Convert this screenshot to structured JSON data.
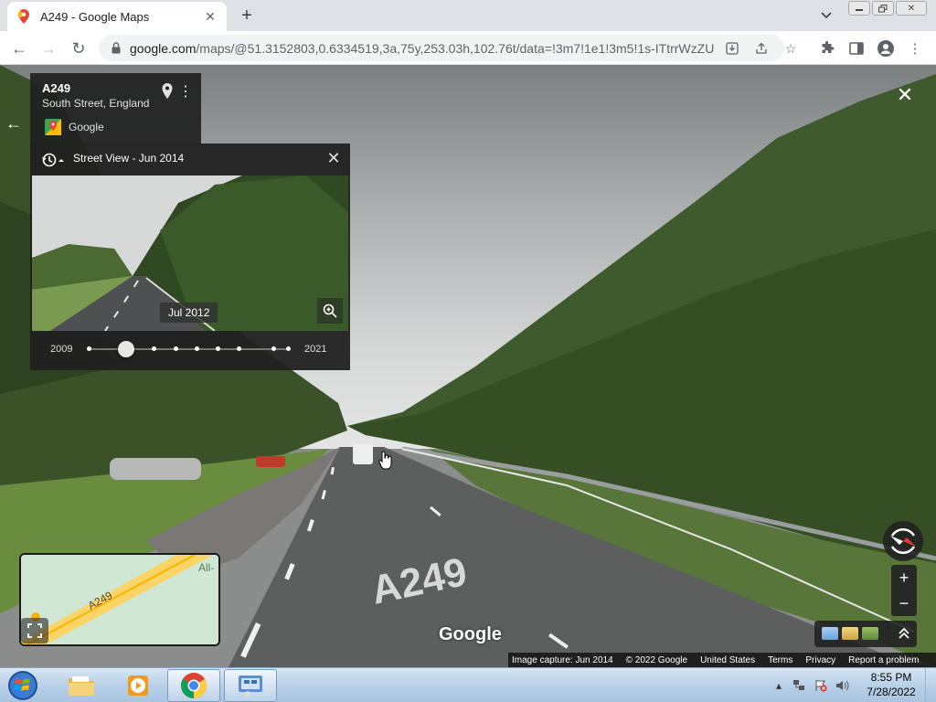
{
  "browser": {
    "tab_title": "A249 - Google Maps",
    "url_domain": "google.com",
    "url_path": "/maps/@51.3152803,0.6334519,3a,75y,253.03h,102.76t/data=!3m7!1e1!3m5!1s-ITtrrWzZU..."
  },
  "place": {
    "title": "A249",
    "subtitle": "South Street, England",
    "brand": "Google"
  },
  "timemachine": {
    "header": "Street View - Jun 2014",
    "thumb_date": "Jul 2012",
    "start_year": "2009",
    "end_year": "2021",
    "selected_position": 0.15
  },
  "minimap": {
    "road_label": "A249",
    "place_label": "All-"
  },
  "watermark": "Google",
  "footer": {
    "capture": "Image capture: Jun 2014",
    "copyright": "© 2022 Google",
    "region": "United States",
    "terms": "Terms",
    "privacy": "Privacy",
    "report": "Report a problem"
  },
  "taskbar": {
    "time": "8:55 PM",
    "date": "7/28/2022"
  },
  "colors": {
    "panel_bg": "#212121",
    "foliage": "#3f5a2c",
    "road": "#5d5f5f",
    "compass_red": "#e53935"
  }
}
